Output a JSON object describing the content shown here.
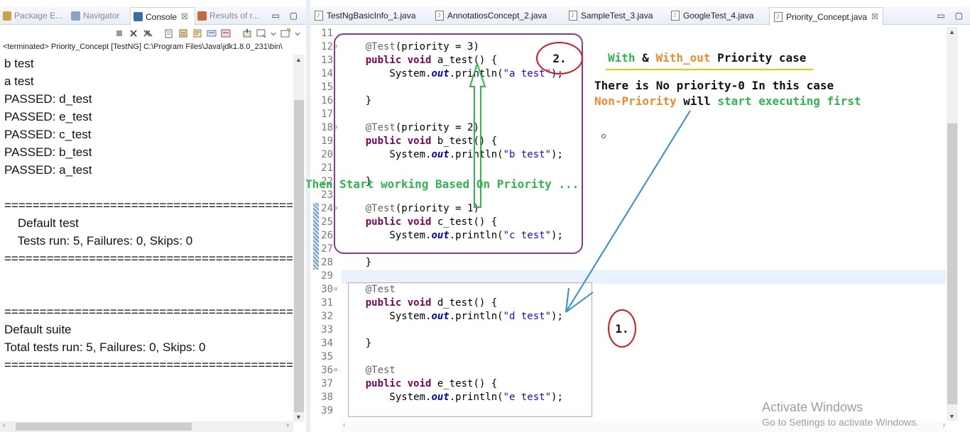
{
  "left_panel": {
    "tabs": [
      {
        "label": "Package E...",
        "icon": "package-explorer-icon",
        "active": false
      },
      {
        "label": "Navigator",
        "icon": "navigator-icon",
        "active": false
      },
      {
        "label": "Console",
        "icon": "console-icon",
        "active": true,
        "close": "☒"
      },
      {
        "label": "Results of r...",
        "icon": "testng-results-icon",
        "active": false
      }
    ],
    "window_buttons": {
      "minimize": "▭",
      "maximize": "▢"
    },
    "status": "<terminated> Priority_Concept [TestNG] C:\\Program Files\\Java\\jdk1.8.0_231\\bin\\",
    "output": [
      "b test",
      "a test",
      "PASSED: d_test",
      "PASSED: e_test",
      "PASSED: c_test",
      "PASSED: b_test",
      "PASSED: a_test",
      "",
      "===============================================",
      "    Default test",
      "    Tests run: 5, Failures: 0, Skips: 0",
      "===============================================",
      "",
      "",
      "===============================================",
      "Default suite",
      "Total tests run: 5, Failures: 0, Skips: 0",
      "==============================================="
    ]
  },
  "editor": {
    "tabs": [
      {
        "label": "TestNgBasicInfo_1.java",
        "active": false
      },
      {
        "label": "AnnotatiosConcept_2.java",
        "active": false
      },
      {
        "label": "SampleTest_3.java",
        "active": false
      },
      {
        "label": "GoogleTest_4.java",
        "active": false
      },
      {
        "label": "Priority_Concept.java",
        "active": true,
        "close": "☒"
      }
    ],
    "window_buttons": {
      "minimize": "▭",
      "maximize": "▢"
    },
    "line_numbers": [
      "11",
      "12",
      "13",
      "14",
      "15",
      "16",
      "17",
      "18",
      "19",
      "20",
      "21",
      "22",
      "23",
      "24",
      "25",
      "26",
      "27",
      "28",
      "29",
      "30",
      "31",
      "32",
      "33",
      "34",
      "35",
      "36",
      "37",
      "38",
      "39"
    ],
    "fold_markers": {
      "12": "⊖",
      "18": "⊖",
      "24": "⊖",
      "30": "⊖",
      "36": "⊖"
    }
  },
  "annotations": {
    "title_with": "With",
    "title_amp": " & ",
    "title_without": "With_out",
    "title_rest": " Priority case",
    "line2": "There is No priority-0 In this  case",
    "line3_orange": "Non-Priority",
    "line3_black1": "  will ",
    "line3_green": "start executing first",
    "priority_note": "Then Start working Based On Priority ...",
    "circle_2": "2.",
    "circle_1": "1."
  },
  "watermark": {
    "line1": "Activate Windows",
    "line2": "Go to Settings to activate Windows."
  },
  "colors": {
    "keyword": "#7f0055",
    "annotation": "#646464",
    "string": "#2a00ff",
    "static_field": "#0000c0",
    "highlight_green": "#2db84a",
    "highlight_orange": "#f08a2a",
    "circle_red": "#e0141e",
    "box_purple": "#8b3a8f",
    "arrow_blue": "#2f8fd8"
  }
}
